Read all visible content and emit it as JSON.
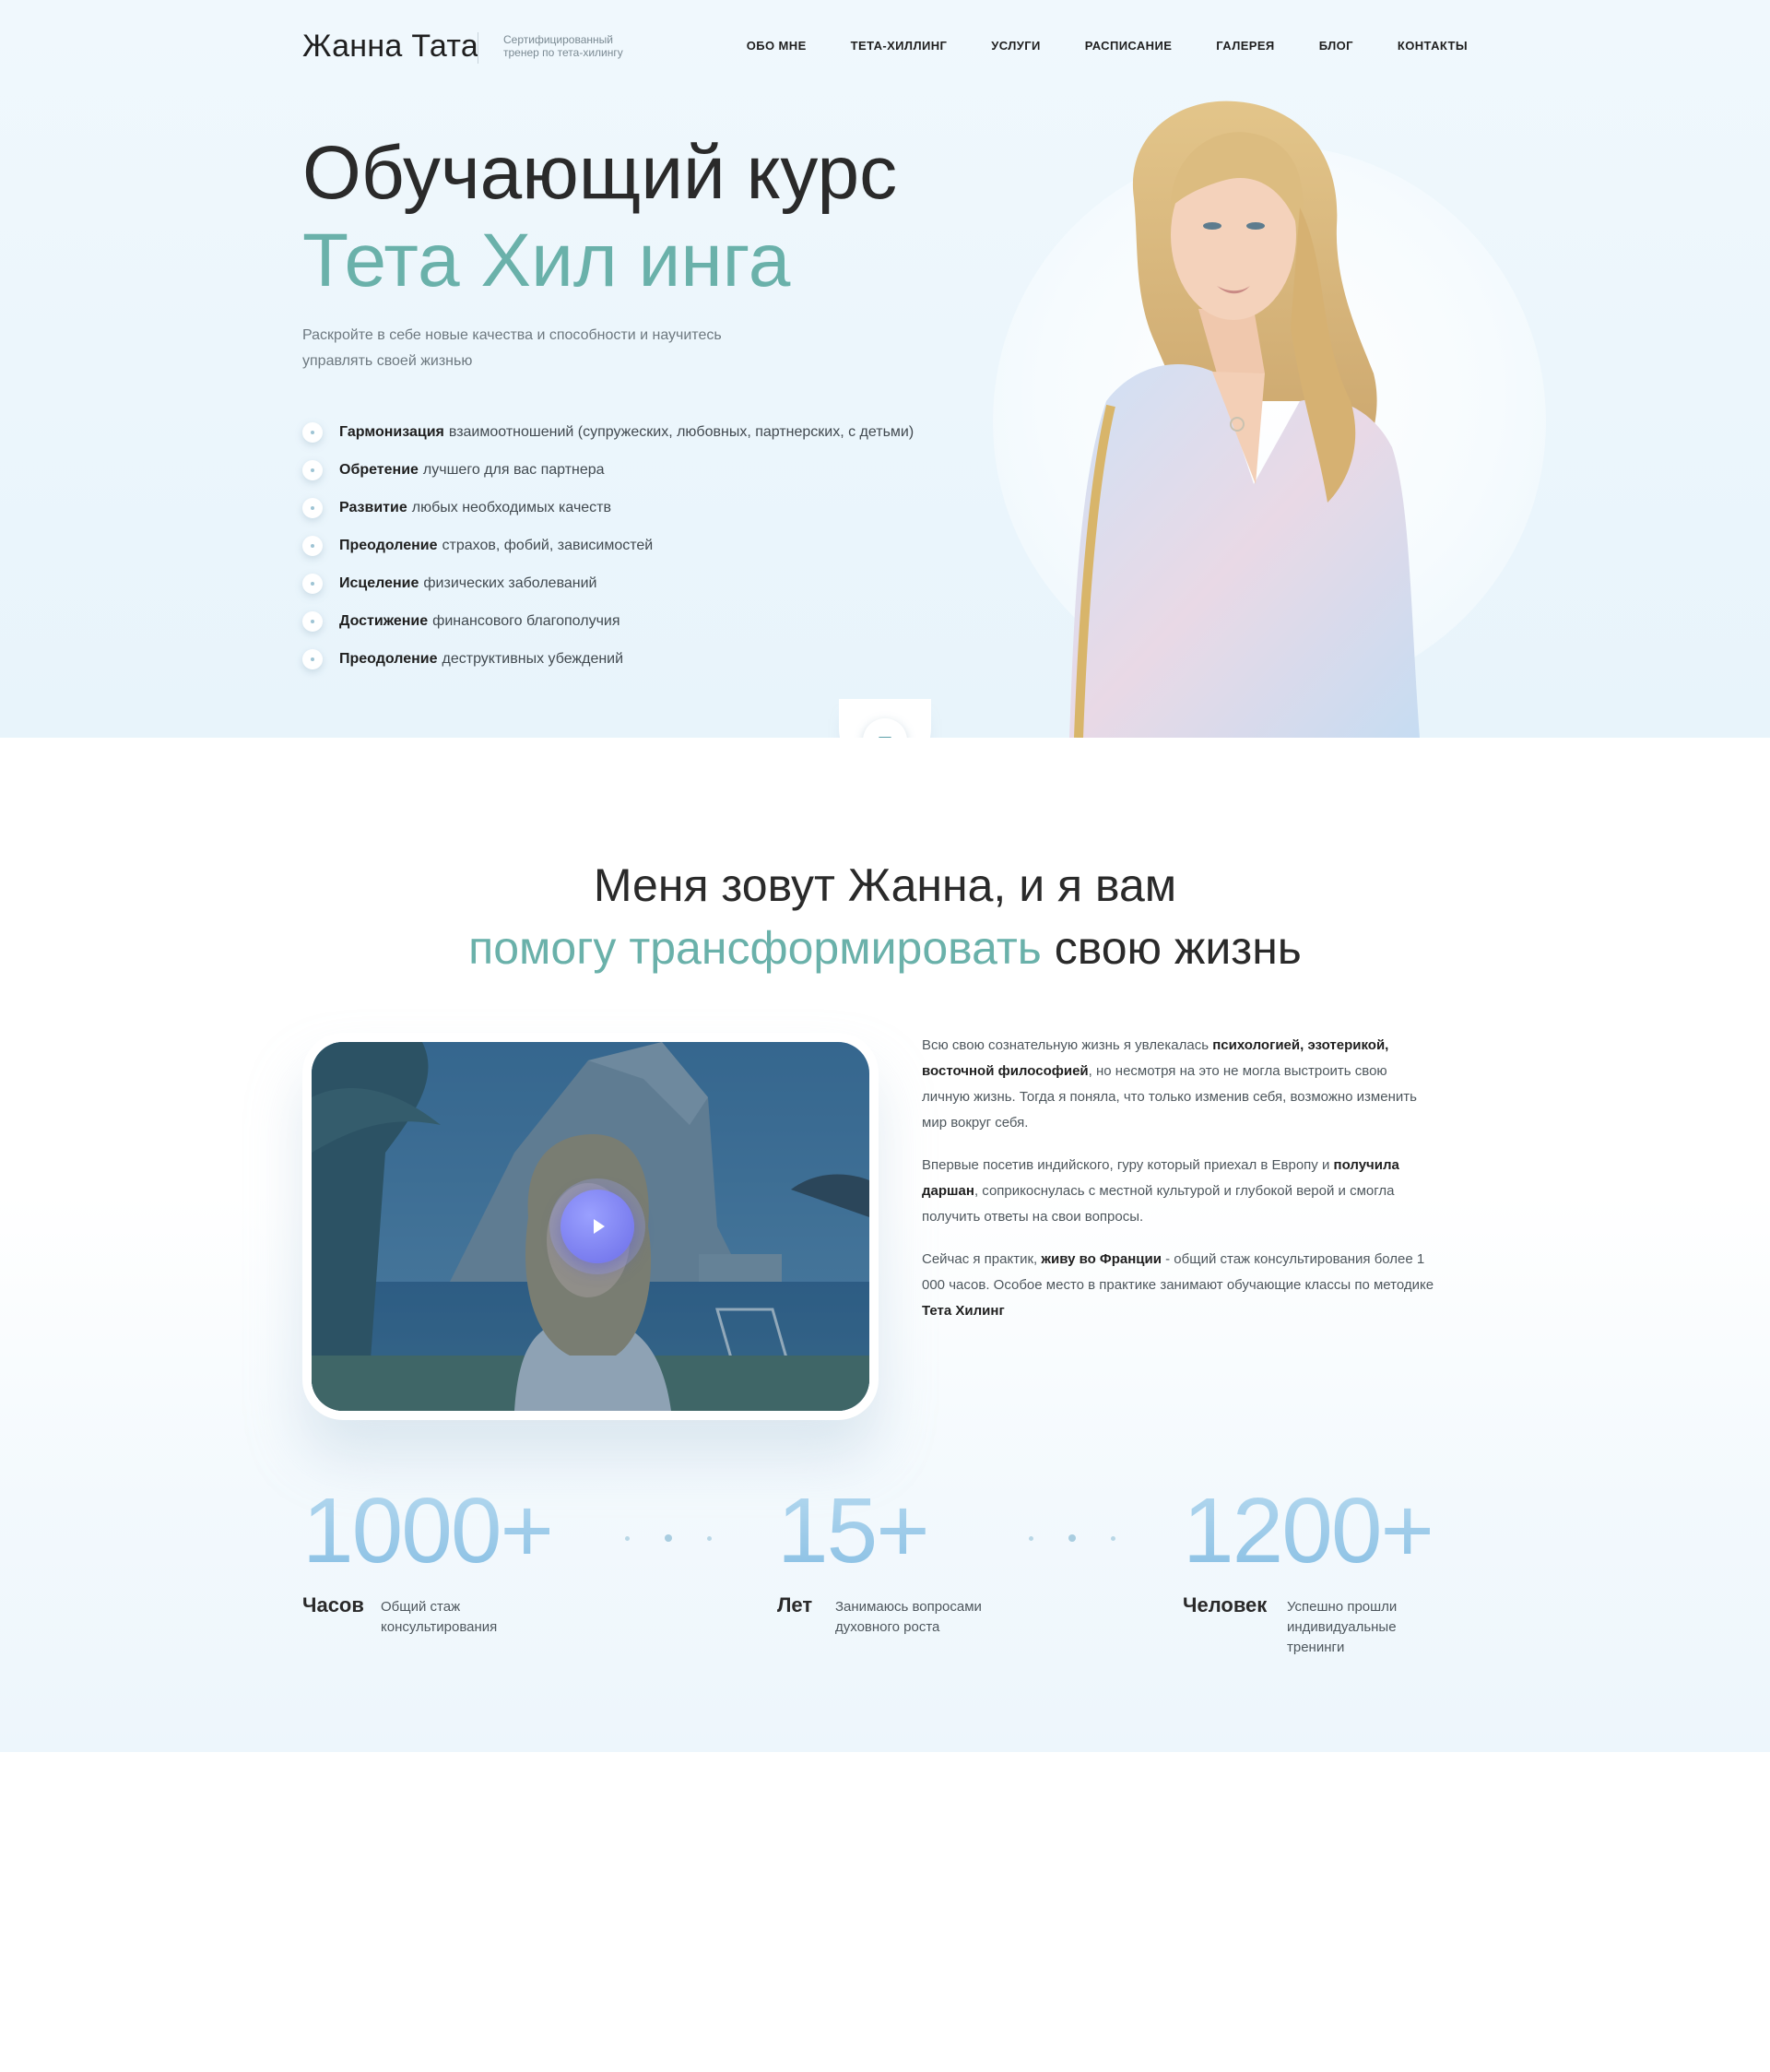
{
  "header": {
    "logo_name": "Жанна Тата",
    "logo_subtitle": "Сертифицированный тренер по тета-хилингу",
    "nav": [
      {
        "label": "ОБО МНЕ"
      },
      {
        "label": "ТЕТА-ХИЛЛИНГ"
      },
      {
        "label": "УСЛУГИ"
      },
      {
        "label": "РАСПИСАНИЕ"
      },
      {
        "label": "ГАЛЕРЕЯ"
      },
      {
        "label": "БЛОГ"
      },
      {
        "label": "КОНТАКТЫ"
      }
    ]
  },
  "hero": {
    "title_line1": "Обучающий курс",
    "title_line2": "Тета Хил инга",
    "subtitle": "Раскройте в себе новые качества и способности и научитесь управлять своей жизнью",
    "benefits": [
      {
        "bold": "Гармонизация",
        "text": "взаимоотношений (супружеских, любовных, партнерских, с детьми)"
      },
      {
        "bold": "Обретение",
        "text": "лучшего для вас партнера"
      },
      {
        "bold": "Развитие",
        "text": "любых необходимых качеств"
      },
      {
        "bold": "Преодоление",
        "text": "страхов, фобий, зависимостей"
      },
      {
        "bold": "Исцеление",
        "text": "физических заболеваний"
      },
      {
        "bold": "Достижение",
        "text": "финансового благополучия"
      },
      {
        "bold": "Преодоление",
        "text": "деструктивных убеждений"
      }
    ]
  },
  "about": {
    "heading_line1": "Меня зовут Жанна, и я вам",
    "heading_accent": "помогу трансформировать",
    "heading_rest": "свою жизнь",
    "p1_a": "Всю свою сознательную жизнь я увлекалась",
    "p1_b": "психологией, эзотерикой, восточной философией",
    "p1_c": ", но несмотря на это не могла выстроить свою личную жизнь. Тогда я поняла, что только изменив себя, возможно изменить мир вокруг себя.",
    "p2_a": "Впервые посетив индийского, гуру который приехал в Европу и",
    "p2_b": "получила даршан",
    "p2_c": ", соприкоснулась с местной культурой и глубокой верой и смогла получить ответы на свои вопросы.",
    "p3_a": "Сейчас я практик,",
    "p3_b": "живу во Франции",
    "p3_c": "- общий стаж консультирования более 1 000 часов.  Особое место в практике занимают обучающие классы  по методике",
    "p3_d": "Тета Хилинг"
  },
  "stats": [
    {
      "value": "1000+",
      "label": "Часов",
      "desc": "Общий стаж консультирования"
    },
    {
      "value": "15+",
      "label": "Лет",
      "desc": "Занимаюсь вопросами духовного роста"
    },
    {
      "value": "1200+",
      "label": "Человек",
      "desc": "Успешно прошли индивидуальные тренинги"
    }
  ],
  "icons": {
    "scroll": "chevron-down-icon",
    "play": "play-icon",
    "bullet": "dot-icon"
  },
  "colors": {
    "accent": "#6ab1aa",
    "stat_blue": "#85bde3",
    "play": "#6c6ee8"
  }
}
